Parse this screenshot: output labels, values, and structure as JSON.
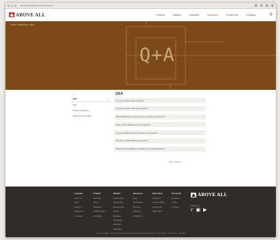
{
  "browser": {
    "url": "aboveall.lighting.com/resources/q-a"
  },
  "brand": {
    "name": "ABOVE ALL",
    "tagline": ""
  },
  "nav": {
    "items": [
      "Products",
      "Markets",
      "Inspiration",
      "Resources",
      "Find An Rep",
      "Company"
    ],
    "active_index": 3
  },
  "hero": {
    "breadcrumb": "Home  /  Resources  /  Q&A",
    "title": "Q+A"
  },
  "sidebar": {
    "items": [
      "Q&A",
      "FAQ",
      "Product Literature",
      "Warranty Information"
    ],
    "selected_index": 0
  },
  "qa": {
    "title": "Q&A",
    "questions": [
      "Are your products DLC certified?",
      "Are your products Title 24 compliant?",
      "What LED power supply does your outdoor products use?",
      "What - L70s warranty for your products?",
      "Can your UFO fans they be used in wet location?",
      "Are your products lighting protection?",
      "What kind of installation methods does the AP light have?"
    ],
    "pagination": "Prev  1  2  Next >"
  },
  "footer": {
    "columns": [
      {
        "heading": "Company",
        "links": [
          "About Us",
          "News",
          "Careers",
          "Contact Us",
          "Locations"
        ]
      },
      {
        "heading": "Projects",
        "links": [
          "Industrial",
          "Retail",
          "Education",
          "Public Spaces",
          "Hospitality"
        ]
      },
      {
        "heading": "Markets",
        "links": [
          "Commercial",
          "Warehouse",
          "Parking Lots",
          "Sports",
          "Roadway",
          "Healthcare",
          "Industrial",
          "Agriculture"
        ]
      },
      {
        "heading": "Resources",
        "links": [
          "Q&A",
          "Downloads",
          "Brochure",
          "Warranty",
          "Installation"
        ]
      },
      {
        "heading": "Find A Rep",
        "links": [
          "Locations",
          "Contact Sales",
          "Distributors",
          "Sales Team"
        ]
      },
      {
        "heading": "Get Social",
        "links": [
          "Facebook",
          "Twitter",
          "YouTube"
        ]
      }
    ],
    "updates_label": "Follow Us",
    "social_icons": [
      "twitter-icon",
      "instagram-icon",
      "youtube-icon"
    ],
    "bottom_text": "Above All Lighting  ·  Copyright © 2021 Above All Lighting Inc. All Rights Reserved  ·  Privacy Policy  ·  Terms of Use  ·  Site Map"
  }
}
